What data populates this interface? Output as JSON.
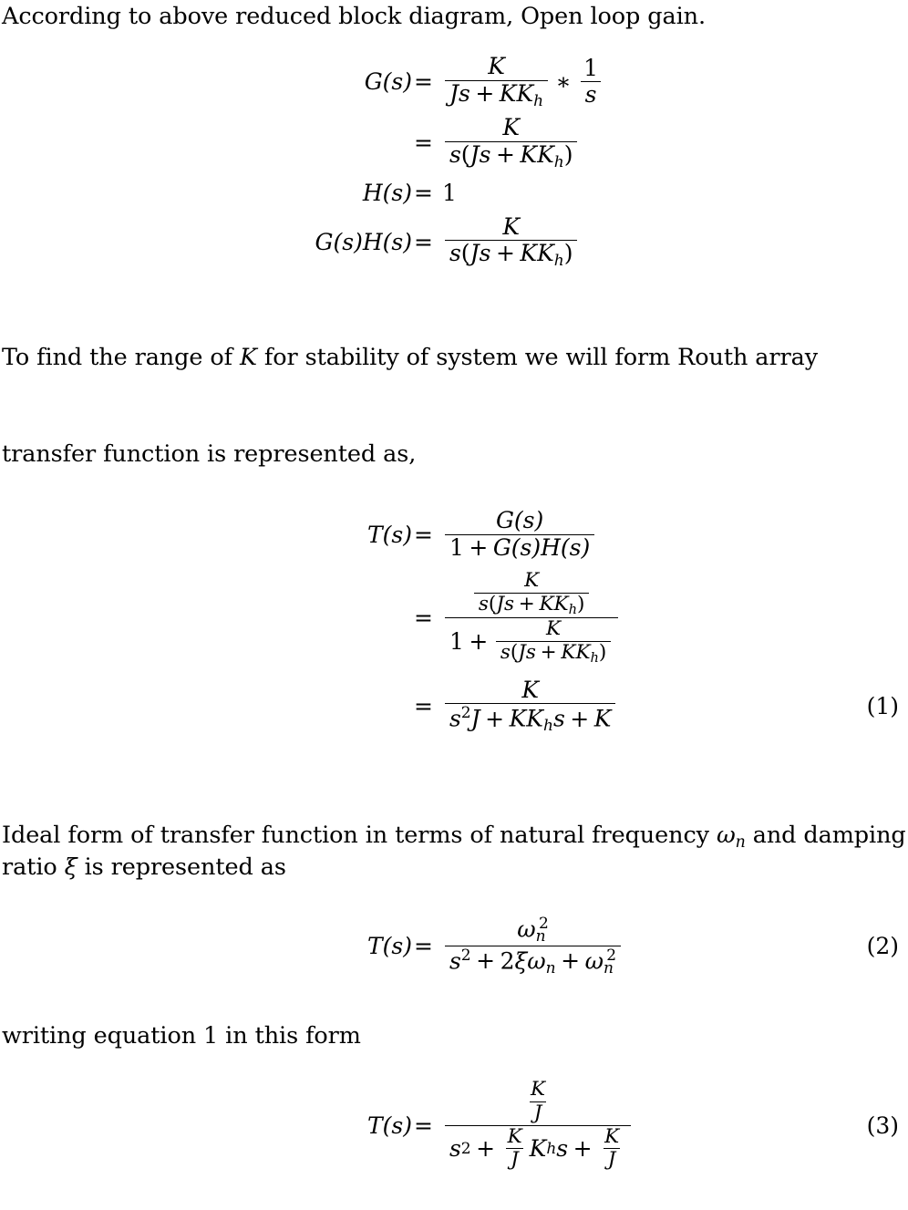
{
  "document": {
    "type": "latex-math-derivation",
    "topic": "Control systems closed-loop transfer function and Routh stability"
  },
  "paragraphs": {
    "intro": {
      "pre": "According to above reduced block diagram, Open loop gain.",
      "full_text": "According to above reduced block diagram, Open loop gain."
    },
    "routh": {
      "part1": "To find the range of ",
      "symbol": "K",
      "part2": " for stability of system we will form Routh array",
      "full_text": "To find the range of K for stability of system we will form Routh array"
    },
    "transfer": {
      "full_text": "transfer function is represented as,"
    },
    "ideal": {
      "part1": "Ideal form of transfer function in terms of natural frequency ",
      "omega": "ω",
      "omega_sub": "n",
      "part2": " and damping ratio ",
      "xi": "ξ",
      "part3": " is represented as",
      "full_text": "Ideal form of transfer function in terms of natural frequency ωn and damping ratio ξ is represented as"
    },
    "writing": {
      "full_text": "writing equation 1 in this form"
    }
  },
  "equations": {
    "block1": {
      "row1": {
        "lhs": "G(s)",
        "eq": "=",
        "num1": "K",
        "den1_J": "J",
        "den1_s": "s",
        "den1_plus": "+",
        "den1_K": "K",
        "den1_Kh": "K",
        "den1_Kh_sub": "h",
        "times": "∗",
        "num2": "1",
        "den2": "s"
      },
      "row2": {
        "eq": "=",
        "num": "K",
        "den_s": "s",
        "den_open": "(",
        "den_J": "J",
        "den_s2": "s",
        "den_plus": "+",
        "den_K": "K",
        "den_Kh": "K",
        "den_Kh_sub": "h",
        "den_close": ")"
      },
      "row3": {
        "lhs": "H(s)",
        "eq": "=",
        "rhs": "1"
      },
      "row4": {
        "lhs": "G(s)H(s)",
        "eq": "=",
        "num": "K",
        "den_s": "s",
        "den_open": "(",
        "den_J": "J",
        "den_s2": "s",
        "den_plus": "+",
        "den_K": "K",
        "den_Kh": "K",
        "den_Kh_sub": "h",
        "den_close": ")"
      }
    },
    "block2": {
      "row1": {
        "lhs": "T(s)",
        "eq": "=",
        "num": "G(s)",
        "den_one": "1",
        "den_plus": "+",
        "den_GH": "G(s)H(s)"
      },
      "row2": {
        "eq": "=",
        "num_num": "K",
        "num_den_s": "s",
        "num_den_open": "(",
        "num_den_J": "J",
        "num_den_s2": "s",
        "num_den_plus": "+",
        "num_den_K": "K",
        "num_den_Kh": "K",
        "num_den_Kh_sub": "h",
        "num_den_close": ")",
        "den_one": "1",
        "den_plus": "+",
        "den_num": "K",
        "den_den_s": "s",
        "den_den_open": "(",
        "den_den_J": "J",
        "den_den_s2": "s",
        "den_den_plus": "+",
        "den_den_K": "K",
        "den_den_Kh": "K",
        "den_den_Kh_sub": "h",
        "den_den_close": ")"
      },
      "row3": {
        "eq": "=",
        "num": "K",
        "den_s": "s",
        "den_s_sup": "2",
        "den_J": "J",
        "den_plus1": "+",
        "den_K": "K",
        "den_Kh": "K",
        "den_Kh_sub": "h",
        "den_s3": "s",
        "den_plus2": "+",
        "den_K2": "K",
        "tag": "(1)"
      }
    },
    "block3": {
      "row1": {
        "lhs": "T(s)",
        "eq": "=",
        "num_omega": "ω",
        "num_sub": "n",
        "num_sup": "2",
        "den_s": "s",
        "den_s_sup": "2",
        "den_plus1": "+",
        "den_two": "2",
        "den_xi": "ξ",
        "den_omega": "ω",
        "den_omega_sub": "n",
        "den_plus2": "+",
        "den_omega2": "ω",
        "den_omega2_sub": "n",
        "den_omega2_sup": "2",
        "tag": "(2)"
      }
    },
    "block4": {
      "row1": {
        "lhs": "T(s)",
        "eq": "=",
        "num_K": "K",
        "num_J": "J",
        "den_s": "s",
        "den_s_sup": "2",
        "den_plus1": "+",
        "den_f1_K": "K",
        "den_f1_J": "J",
        "den_Kh": "K",
        "den_Kh_sub": "h",
        "den_s2": "s",
        "den_plus2": "+",
        "den_f2_K": "K",
        "den_f2_J": "J",
        "tag": "(3)"
      }
    }
  }
}
